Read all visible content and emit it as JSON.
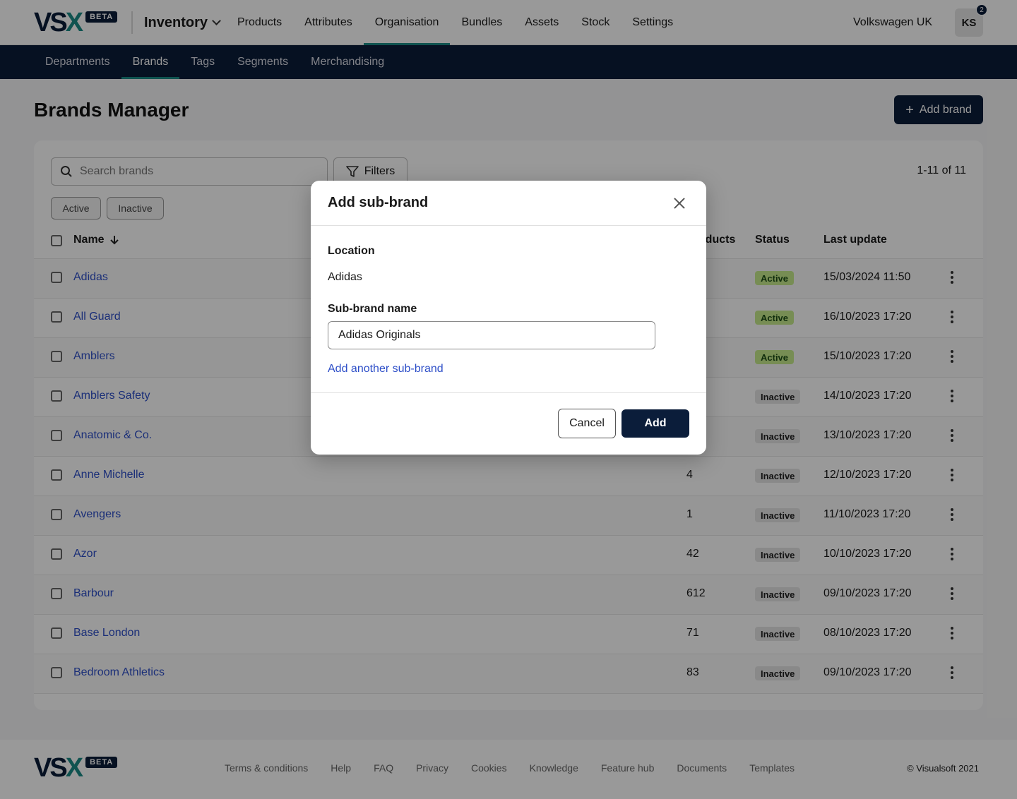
{
  "header": {
    "logo": "VSX",
    "beta": "BETA",
    "app_selector": "Inventory",
    "nav": [
      "Products",
      "Attributes",
      "Organisation",
      "Bundles",
      "Assets",
      "Stock",
      "Settings"
    ],
    "active_nav": "Organisation",
    "org_name": "Volkswagen UK",
    "avatar_initials": "KS",
    "notification_count": "2"
  },
  "subnav": {
    "items": [
      "Departments",
      "Brands",
      "Tags",
      "Segments",
      "Merchandising"
    ],
    "active": "Brands"
  },
  "page": {
    "title": "Brands Manager",
    "add_button": "Add brand",
    "search_placeholder": "Search brands",
    "filters_label": "Filters",
    "result_count": "1-11 of 11",
    "chips": [
      "Active",
      "Inactive"
    ]
  },
  "table": {
    "columns": {
      "name": "Name",
      "products": "Products",
      "status": "Status",
      "last_update": "Last update"
    },
    "rows": [
      {
        "name": "Adidas",
        "products": "",
        "status": "Active",
        "last_update": "15/03/2024 11:50"
      },
      {
        "name": "All Guard",
        "products": "",
        "status": "Active",
        "last_update": "16/10/2023 17:20"
      },
      {
        "name": "Amblers",
        "products": "",
        "status": "Active",
        "last_update": "15/10/2023 17:20"
      },
      {
        "name": "Amblers Safety",
        "products": "",
        "status": "Inactive",
        "last_update": "14/10/2023 17:20"
      },
      {
        "name": "Anatomic & Co.",
        "products": "",
        "status": "Inactive",
        "last_update": "13/10/2023 17:20"
      },
      {
        "name": "Anne Michelle",
        "products": "4",
        "status": "Inactive",
        "last_update": "12/10/2023 17:20"
      },
      {
        "name": "Avengers",
        "products": "1",
        "status": "Inactive",
        "last_update": "11/10/2023 17:20"
      },
      {
        "name": "Azor",
        "products": "42",
        "status": "Inactive",
        "last_update": "10/10/2023 17:20"
      },
      {
        "name": "Barbour",
        "products": "612",
        "status": "Inactive",
        "last_update": "09/10/2023 17:20"
      },
      {
        "name": "Base London",
        "products": "71",
        "status": "Inactive",
        "last_update": "08/10/2023 17:20"
      },
      {
        "name": "Bedroom Athletics",
        "products": "83",
        "status": "Inactive",
        "last_update": "09/10/2023 17:20"
      }
    ]
  },
  "modal": {
    "title": "Add sub-brand",
    "location_label": "Location",
    "location_value": "Adidas",
    "sub_brand_label": "Sub-brand name",
    "sub_brand_value": "Adidas Originals",
    "add_another": "Add another sub-brand",
    "cancel": "Cancel",
    "add": "Add"
  },
  "footer": {
    "links": [
      "Terms & conditions",
      "Help",
      "FAQ",
      "Privacy",
      "Cookies",
      "Knowledge",
      "Feature hub",
      "Documents",
      "Templates"
    ],
    "copyright": "© Visualsoft 2021"
  },
  "colors": {
    "navy": "#0b1d3a",
    "teal": "#1a8a86",
    "link_blue": "#2e4fc8",
    "active_badge": "#c6eb8c",
    "inactive_badge": "#e4e4e4"
  }
}
